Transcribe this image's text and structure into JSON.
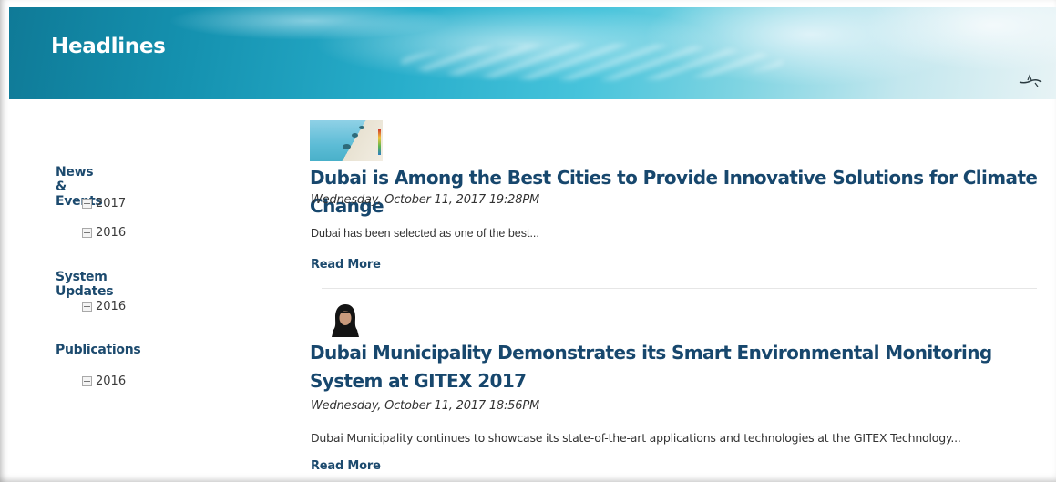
{
  "banner": {
    "title": "Headlines",
    "decor_icon": "bird-icon"
  },
  "sidebar": {
    "sections": [
      {
        "heading": "News & Events",
        "items": [
          "2017",
          "2016"
        ]
      },
      {
        "heading": "System Updates",
        "items": [
          "2016"
        ]
      },
      {
        "heading": "Publications",
        "items": [
          "2016"
        ]
      }
    ],
    "expand_icon": "plus-icon"
  },
  "articles": [
    {
      "title": "Dubai is Among the Best Cities to Provide Innovative Solutions for Climate Change",
      "date": "Wednesday, October 11, 2017 19:28PM",
      "summary": "Dubai has been selected as one of the best...",
      "read_more": "Read More"
    },
    {
      "title": "Dubai Municipality Demonstrates its Smart Environmental Monitoring System at GITEX 2017",
      "date": "Wednesday, October 11, 2017 18:56PM",
      "summary": "Dubai Municipality continues to showcase its state-of-the-art applications and technologies at the GITEX Technology...",
      "read_more": "Read More"
    }
  ],
  "colors": {
    "heading": "#1c4a6e",
    "title": "#17476d",
    "banner_start": "#0f7a97"
  }
}
